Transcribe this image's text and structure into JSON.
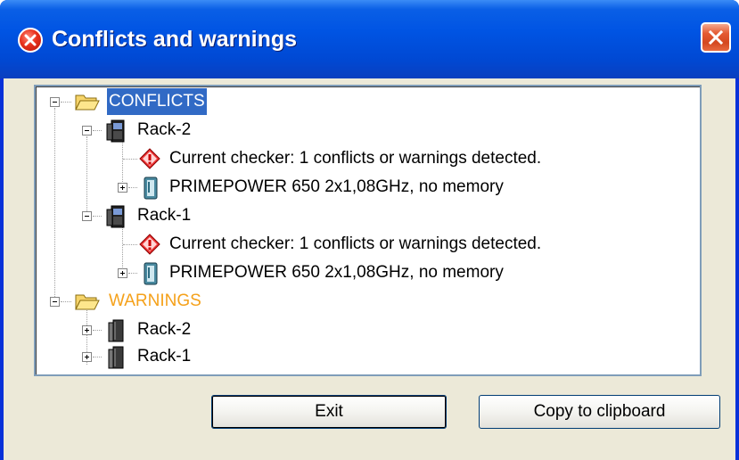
{
  "window": {
    "title": "Conflicts and warnings",
    "title_icon": "error-icon",
    "close_icon": "close-icon"
  },
  "tree": {
    "conflicts": {
      "label": "CONFLICTS",
      "racks": [
        {
          "label": "Rack-2",
          "message": "Current checker: 1 conflicts or warnings detected.",
          "server": "PRIMEPOWER 650 2x1,08GHz, no memory"
        },
        {
          "label": "Rack-1",
          "message": "Current checker: 1 conflicts or warnings detected.",
          "server": "PRIMEPOWER 650 2x1,08GHz, no memory"
        }
      ]
    },
    "warnings": {
      "label": "WARNINGS",
      "racks": [
        {
          "label": "Rack-2"
        },
        {
          "label": "Rack-1"
        }
      ]
    }
  },
  "buttons": {
    "exit": "Exit",
    "copy": "Copy to clipboard"
  },
  "colors": {
    "selection": "#316ac5",
    "warnings_label": "#f5a11a",
    "title_bar": "#0054e3"
  }
}
